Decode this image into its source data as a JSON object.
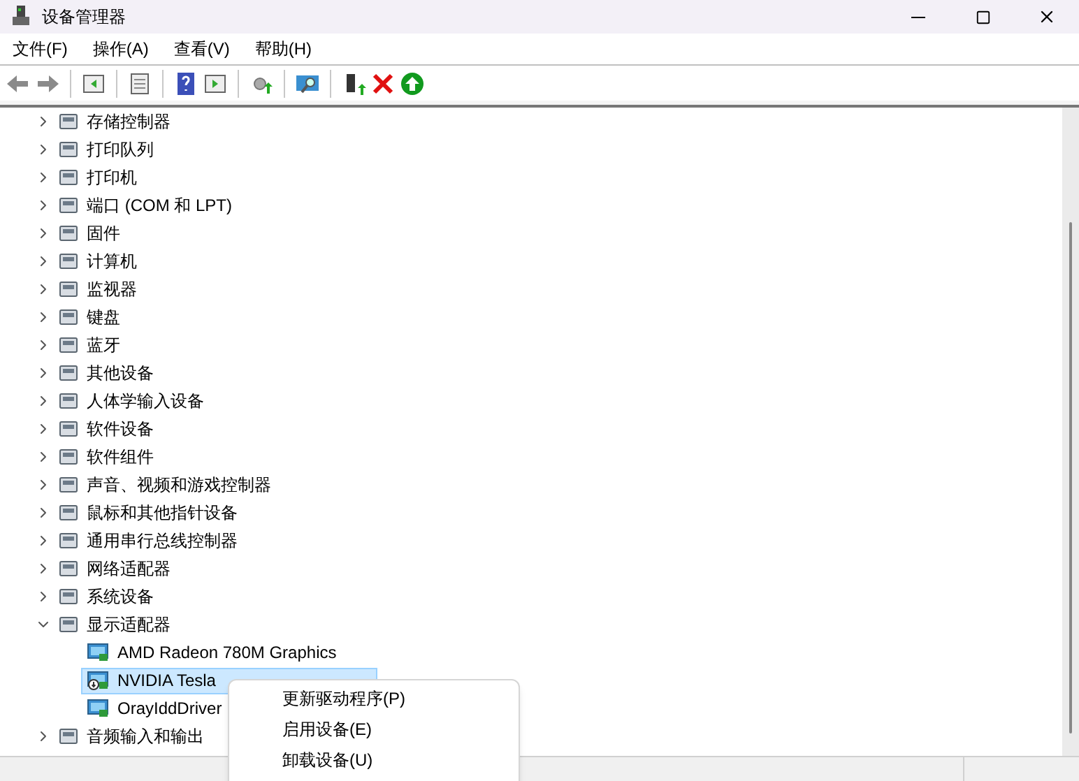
{
  "window": {
    "title": "设备管理器"
  },
  "menu_bar": [
    "文件(F)",
    "操作(A)",
    "查看(V)",
    "帮助(H)"
  ],
  "tree": [
    {
      "label": "存储控制器",
      "expanded": false
    },
    {
      "label": "打印队列",
      "expanded": false
    },
    {
      "label": "打印机",
      "expanded": false
    },
    {
      "label": "端口 (COM 和 LPT)",
      "expanded": false
    },
    {
      "label": "固件",
      "expanded": false
    },
    {
      "label": "计算机",
      "expanded": false
    },
    {
      "label": "监视器",
      "expanded": false
    },
    {
      "label": "键盘",
      "expanded": false
    },
    {
      "label": "蓝牙",
      "expanded": false
    },
    {
      "label": "其他设备",
      "expanded": false
    },
    {
      "label": "人体学输入设备",
      "expanded": false
    },
    {
      "label": "软件设备",
      "expanded": false
    },
    {
      "label": "软件组件",
      "expanded": false
    },
    {
      "label": "声音、视频和游戏控制器",
      "expanded": false
    },
    {
      "label": "鼠标和其他指针设备",
      "expanded": false
    },
    {
      "label": "通用串行总线控制器",
      "expanded": false
    },
    {
      "label": "网络适配器",
      "expanded": false
    },
    {
      "label": "系统设备",
      "expanded": false
    },
    {
      "label": "显示适配器",
      "expanded": true,
      "children": [
        {
          "label": "AMD Radeon 780M Graphics",
          "selected": false,
          "disabled": false
        },
        {
          "label": "NVIDIA Tesla",
          "selected": true,
          "disabled": true
        },
        {
          "label": "OrayIddDriver",
          "selected": false,
          "disabled": false
        }
      ]
    },
    {
      "label": "音频输入和输出",
      "expanded": false
    }
  ],
  "context_menu": [
    "更新驱动程序(P)",
    "启用设备(E)",
    "卸载设备(U)"
  ]
}
